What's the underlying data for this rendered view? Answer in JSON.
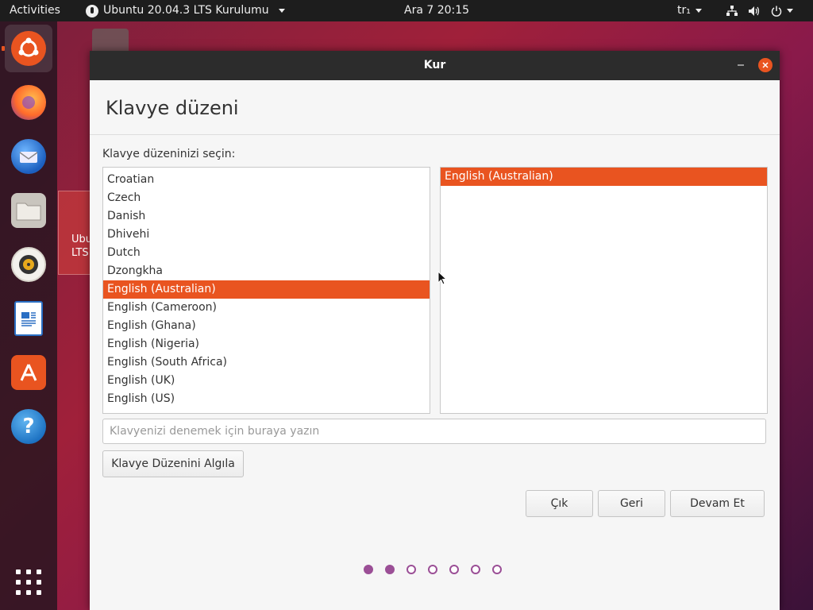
{
  "topbar": {
    "activities": "Activities",
    "app_menu": "Ubuntu 20.04.3 LTS Kurulumu",
    "clock": "Ara 7  20:15",
    "keyboard_lang": "tr₁",
    "icons": [
      "network-icon",
      "volume-icon",
      "power-icon"
    ]
  },
  "dock": {
    "items": [
      "ubuntu-installer-icon",
      "firefox-icon",
      "thunderbird-icon",
      "files-icon",
      "rhythmbox-icon",
      "libreoffice-writer-icon",
      "software-center-icon",
      "help-icon"
    ],
    "show_apps": "show-applications-icon"
  },
  "desktop": {
    "tile_label": "Ubu\nLTS"
  },
  "window": {
    "title": "Kur",
    "header": "Klavye düzeni",
    "prompt": "Klavye düzeninizi seçin:",
    "layouts": [
      "Croatian",
      "Czech",
      "Danish",
      "Dhivehi",
      "Dutch",
      "Dzongkha",
      "English (Australian)",
      "English (Cameroon)",
      "English (Ghana)",
      "English (Nigeria)",
      "English (South Africa)",
      "English (UK)",
      "English (US)"
    ],
    "selected_layout": "English (Australian)",
    "variants": [
      "English (Australian)"
    ],
    "selected_variant": "English (Australian)",
    "test_placeholder": "Klavyenizi denemek için buraya yazın",
    "detect_button": "Klavye Düzenini Algıla",
    "quit_button": "Çık",
    "back_button": "Geri",
    "continue_button": "Devam Et",
    "progress": {
      "total_steps": 7,
      "completed_steps": 2
    }
  },
  "colors": {
    "accent": "#e95420",
    "progress": "#9b4f96",
    "titlebar": "#2c2c2c"
  }
}
